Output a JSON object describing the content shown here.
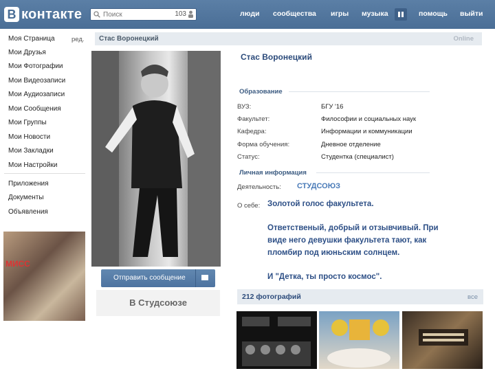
{
  "topbar": {
    "logo_letter": "В",
    "logo_text": "контакте",
    "search_placeholder": "Поиск",
    "search_count": "103",
    "nav": [
      "люди",
      "сообщества",
      "игры",
      "музыка",
      "помощь",
      "выйти"
    ]
  },
  "menu": {
    "items": [
      "Моя Страница",
      "Мои Друзья",
      "Мои Фотографии",
      "Мои Видеозаписи",
      "Мои Аудиозаписи",
      "Мои Сообщения",
      "Мои Группы",
      "Мои Новости",
      "Мои Закладки",
      "Мои Настройки"
    ],
    "edit_label": "ред.",
    "extra_items": [
      "Приложения",
      "Документы",
      "Объявления"
    ],
    "ad_word": "МИСС"
  },
  "header": {
    "name": "Стас Воронецкий",
    "status": "Online"
  },
  "profile": {
    "name": "Стас Воронецкий",
    "send_message": "Отправить сообщение",
    "group_label": "В Студсоюзе",
    "education_title": "Образование",
    "education": [
      {
        "label": "ВУЗ:",
        "value": "БГУ '16"
      },
      {
        "label": "Факультет:",
        "value": "Философии и социальных наук"
      },
      {
        "label": "Кафедра:",
        "value": "Информации и коммуникации"
      },
      {
        "label": "Форма обучения:",
        "value": "Дневное отделение"
      },
      {
        "label": "Статус:",
        "value": "Студентка (специалист)"
      }
    ],
    "personal_title": "Личная информация",
    "activity_label": "Деятельность:",
    "activity_value": "СТУДСОЮЗ",
    "about_label": "О себе:",
    "about_lines": [
      "Золотой голос факультета.",
      "Ответственый, добрый и отзывчивый. При",
      "виде него девушки факультета тают, как",
      "пломбир под июньским солнцем.",
      "И \"Детка, ты просто космос\"."
    ]
  },
  "photos": {
    "title": "212 фотографий",
    "all_label": "все"
  },
  "colors": {
    "topbar": "#4a6e96",
    "link": "#2b4a7a",
    "accent": "#4a7bb8"
  }
}
